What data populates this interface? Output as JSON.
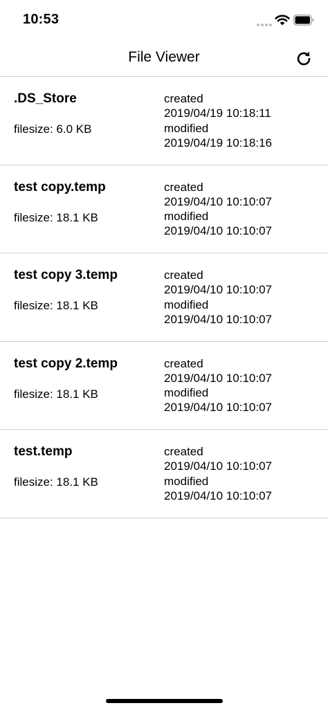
{
  "status_bar": {
    "time": "10:53"
  },
  "nav": {
    "title": "File Viewer",
    "refresh_icon": "refresh-icon"
  },
  "files": [
    {
      "name": ".DS_Store",
      "filesize": "filesize: 6.0 KB",
      "created_label": "created",
      "created": "2019/04/19 10:18:11",
      "modified_label": "modified",
      "modified": "2019/04/19 10:18:16"
    },
    {
      "name": "test copy.temp",
      "filesize": "filesize: 18.1 KB",
      "created_label": "created",
      "created": "2019/04/10 10:10:07",
      "modified_label": "modified",
      "modified": "2019/04/10 10:10:07"
    },
    {
      "name": "test copy 3.temp",
      "filesize": "filesize: 18.1 KB",
      "created_label": "created",
      "created": "2019/04/10 10:10:07",
      "modified_label": "modified",
      "modified": "2019/04/10 10:10:07"
    },
    {
      "name": "test copy 2.temp",
      "filesize": "filesize: 18.1 KB",
      "created_label": "created",
      "created": "2019/04/10 10:10:07",
      "modified_label": "modified",
      "modified": "2019/04/10 10:10:07"
    },
    {
      "name": "test.temp",
      "filesize": "filesize: 18.1 KB",
      "created_label": "created",
      "created": "2019/04/10 10:10:07",
      "modified_label": "modified",
      "modified": "2019/04/10 10:10:07"
    }
  ]
}
